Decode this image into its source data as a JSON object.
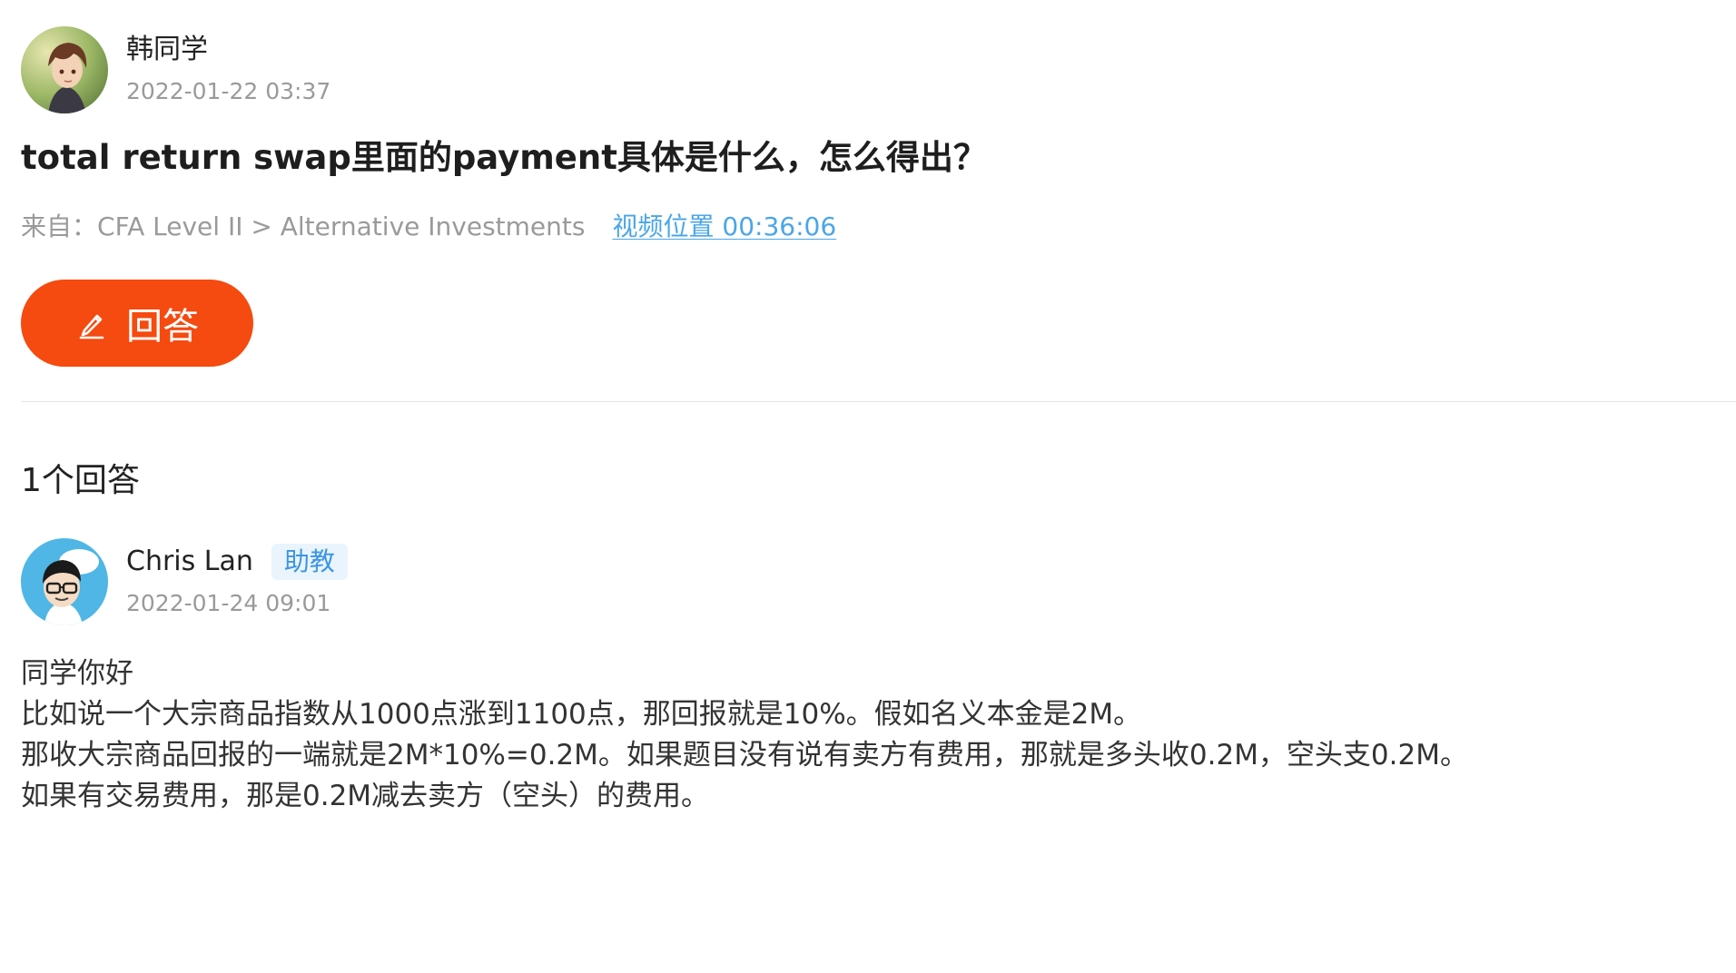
{
  "question": {
    "author_name": "韩同学",
    "time": "2022-01-22 03:37",
    "title": "total return swap里面的payment具体是什么，怎么得出？",
    "source_prefix": "来自：",
    "source_path": "CFA Level II > Alternative Investments",
    "video_label": "视频位置",
    "video_time": "00:36:06",
    "answer_button_label": "回答"
  },
  "answers_count_label": "1个回答",
  "answer": {
    "author_name": "Chris Lan",
    "badge": "助教",
    "time": "2022-01-24 09:01",
    "lines": [
      "同学你好",
      "比如说一个大宗商品指数从1000点涨到1100点，那回报就是10%。假如名义本金是2M。",
      "那收大宗商品回报的一端就是2M*10%=0.2M。如果题目没有说有卖方有费用，那就是多头收0.2M，空头支0.2M。",
      "如果有交易费用，那是0.2M减去卖方（空头）的费用。"
    ]
  },
  "colors": {
    "accent_orange": "#f54a10",
    "link_blue": "#4aa6e8",
    "badge_bg": "#eaf4fd",
    "badge_text": "#3c95e4",
    "muted_text": "#9a9a9a"
  },
  "icons": {
    "answer_button_icon": "pencil-icon"
  }
}
